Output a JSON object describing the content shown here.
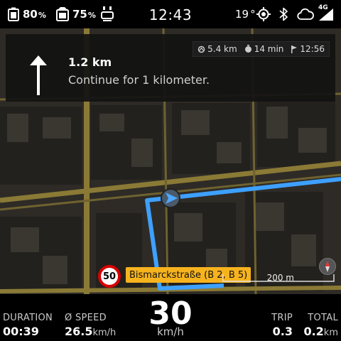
{
  "status": {
    "battery1": {
      "value": "80",
      "unit": "%"
    },
    "battery2": {
      "value": "75",
      "unit": "%"
    },
    "time": "12:43",
    "temperature": {
      "value": "19",
      "unit": "°"
    },
    "network": "4G",
    "icons": [
      "phone-battery-icon",
      "device-battery-icon",
      "bike-icon",
      "gps-icon",
      "bluetooth-icon",
      "cloud-icon",
      "signal-icon"
    ]
  },
  "navigation": {
    "distance": "1.2 km",
    "instruction": "Continue for 1 kilometer.",
    "maneuver": "straight-arrow-icon",
    "trip_info": {
      "remaining_distance": "5.4 km",
      "remaining_time": "14 min",
      "arrival_time": "12:56"
    }
  },
  "map": {
    "speed_limit": "50",
    "street": "Bismarckstraße (B 2, B 5)",
    "scale": "200 m",
    "route_color": "#3ea0ff",
    "road_color": "#8a7a36"
  },
  "dashboard": {
    "duration": {
      "label": "DURATION",
      "value": "00:39"
    },
    "avg_speed": {
      "label": "Ø SPEED",
      "value": "26.5",
      "unit": "km/h"
    },
    "speed": {
      "value": "30",
      "unit": "km/h"
    },
    "trip": {
      "label": "TRIP",
      "value": "0.3"
    },
    "total": {
      "label": "TOTAL",
      "value": "0.2",
      "unit": "km"
    }
  }
}
